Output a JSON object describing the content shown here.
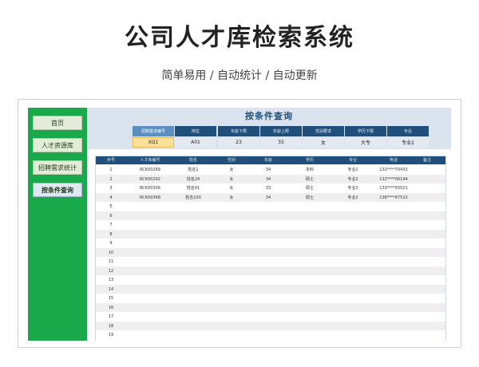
{
  "header": {
    "title": "公司人才库检索系统",
    "subtitle": "简单易用 / 自动统计 / 自动更新"
  },
  "sidebar": {
    "items": [
      {
        "label": "首页",
        "active": false
      },
      {
        "label": "人才资源库",
        "active": false
      },
      {
        "label": "招聘需求统计",
        "active": false
      },
      {
        "label": "按条件查询",
        "active": true
      }
    ]
  },
  "query": {
    "title": "按条件查询",
    "headers": [
      "招聘需求编号",
      "岗位",
      "年龄下限",
      "年龄上限",
      "性别要求",
      "学历下限",
      "专业"
    ],
    "values": [
      "XQ1",
      "A01",
      "23",
      "35",
      "女",
      "大专",
      "专业2"
    ]
  },
  "results": {
    "columns": [
      "序号",
      "人才库编号",
      "姓名",
      "性别",
      "年龄",
      "学历",
      "专业",
      "电话",
      "备注"
    ],
    "rows": [
      [
        "1",
        "RCK00269",
        "姓名1",
        "女",
        "34",
        "本科",
        "专业2",
        "132****70433",
        ""
      ],
      [
        "2",
        "RCK00292",
        "姓名24",
        "女",
        "34",
        "硕士",
        "专业2",
        "132****06194",
        ""
      ],
      [
        "3",
        "RCK00309",
        "姓名41",
        "女",
        "33",
        "硕士",
        "专业2",
        "133****55021",
        ""
      ],
      [
        "4",
        "RCK00368",
        "姓名100",
        "女",
        "34",
        "硕士",
        "专业2",
        "136****87513",
        ""
      ],
      [
        "5",
        "",
        "",
        "",
        "",
        "",
        "",
        "",
        ""
      ],
      [
        "6",
        "",
        "",
        "",
        "",
        "",
        "",
        "",
        ""
      ],
      [
        "7",
        "",
        "",
        "",
        "",
        "",
        "",
        "",
        ""
      ],
      [
        "8",
        "",
        "",
        "",
        "",
        "",
        "",
        "",
        ""
      ],
      [
        "9",
        "",
        "",
        "",
        "",
        "",
        "",
        "",
        ""
      ],
      [
        "10",
        "",
        "",
        "",
        "",
        "",
        "",
        "",
        ""
      ],
      [
        "11",
        "",
        "",
        "",
        "",
        "",
        "",
        "",
        ""
      ],
      [
        "12",
        "",
        "",
        "",
        "",
        "",
        "",
        "",
        ""
      ],
      [
        "13",
        "",
        "",
        "",
        "",
        "",
        "",
        "",
        ""
      ],
      [
        "14",
        "",
        "",
        "",
        "",
        "",
        "",
        "",
        ""
      ],
      [
        "15",
        "",
        "",
        "",
        "",
        "",
        "",
        "",
        ""
      ],
      [
        "16",
        "",
        "",
        "",
        "",
        "",
        "",
        "",
        ""
      ],
      [
        "17",
        "",
        "",
        "",
        "",
        "",
        "",
        "",
        ""
      ],
      [
        "18",
        "",
        "",
        "",
        "",
        "",
        "",
        "",
        ""
      ],
      [
        "19",
        "",
        "",
        "",
        "",
        "",
        "",
        "",
        ""
      ]
    ]
  },
  "colors": {
    "sidebar": "#19a84a",
    "header_blue": "#1f4f7a",
    "highlight_yellow": "#fce09a"
  }
}
